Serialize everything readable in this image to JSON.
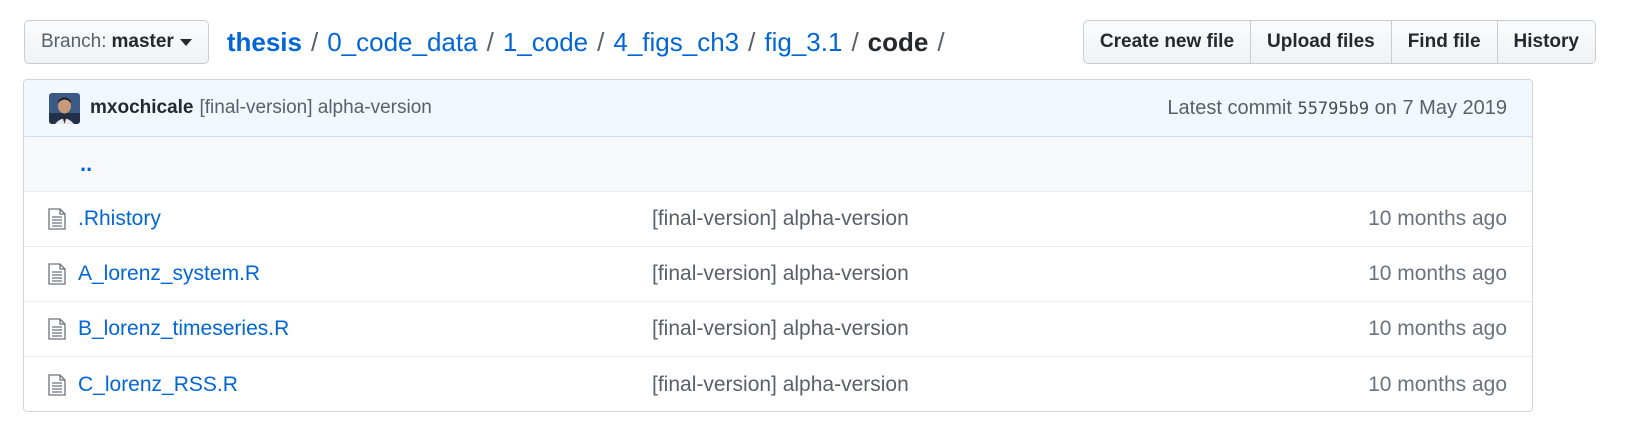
{
  "branch": {
    "prefix": "Branch:",
    "name": "master"
  },
  "breadcrumb": [
    {
      "label": "thesis"
    },
    {
      "label": "0_code_data"
    },
    {
      "label": "1_code"
    },
    {
      "label": "4_figs_ch3"
    },
    {
      "label": "fig_3.1"
    }
  ],
  "breadcrumb_current": "code",
  "separator": "/",
  "buttons": {
    "create_new_file": "Create new file",
    "upload_files": "Upload files",
    "find_file": "Find file",
    "history": "History"
  },
  "commit": {
    "author": "mxochicale",
    "message": "[final-version] alpha-version",
    "latest_label": "Latest commit",
    "sha": "55795b9",
    "date_text": "on 7 May 2019"
  },
  "parent_dir_label": "..",
  "files": [
    {
      "name": ".Rhistory",
      "icon": "file-icon",
      "commit_message": "[final-version] alpha-version",
      "age": "10 months ago"
    },
    {
      "name": "A_lorenz_system.R",
      "icon": "file-icon",
      "commit_message": "[final-version] alpha-version",
      "age": "10 months ago"
    },
    {
      "name": "B_lorenz_timeseries.R",
      "icon": "file-icon",
      "commit_message": "[final-version] alpha-version",
      "age": "10 months ago"
    },
    {
      "name": "C_lorenz_RSS.R",
      "icon": "file-icon",
      "commit_message": "[final-version] alpha-version",
      "age": "10 months ago"
    }
  ],
  "colors": {
    "link": "#0366d6",
    "commit_bar": "#f1f8ff",
    "border": "#d1d5da"
  }
}
